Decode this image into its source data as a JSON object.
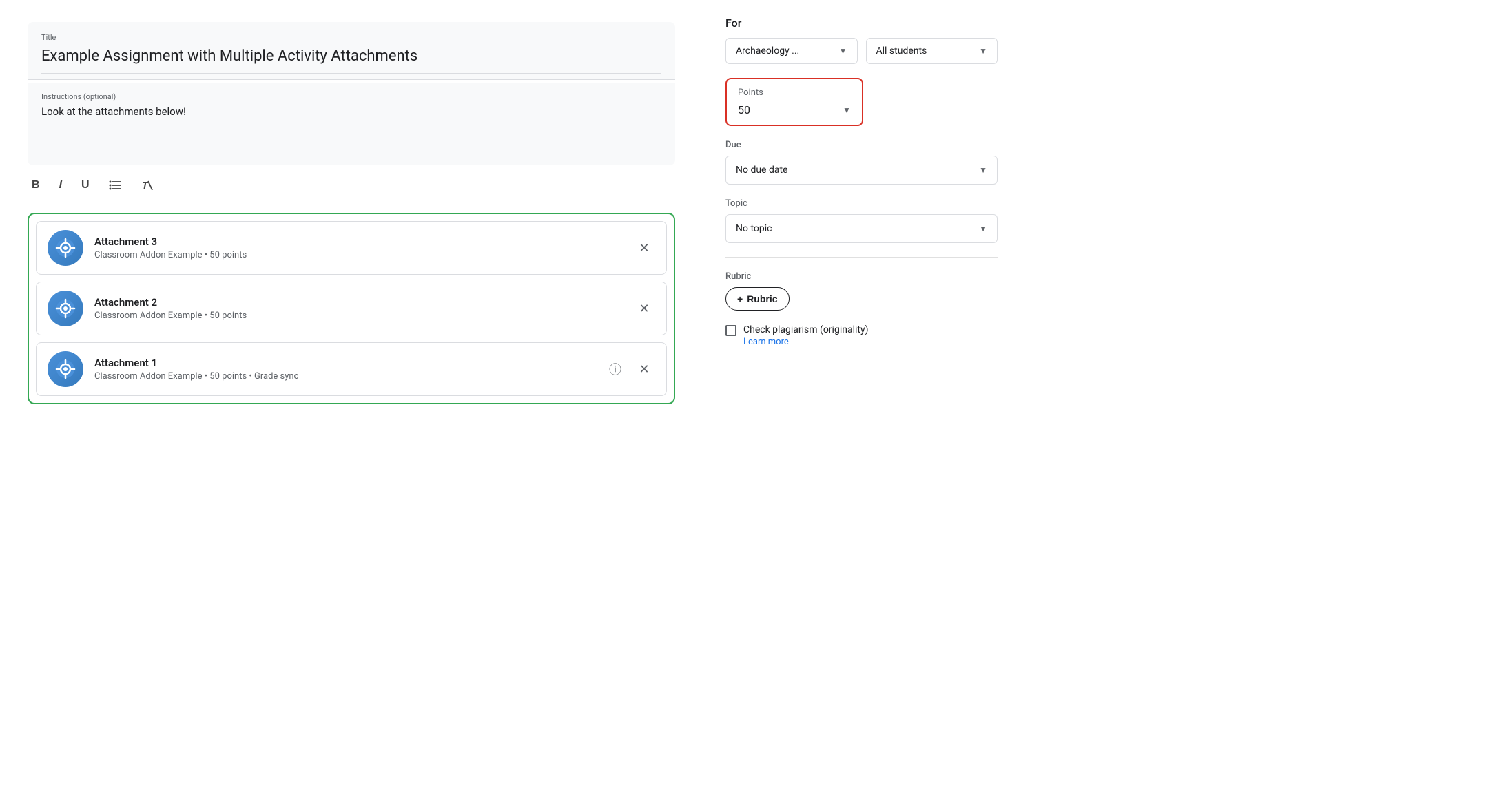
{
  "mainPanel": {
    "title": {
      "label": "Title",
      "value": "Example Assignment with Multiple Activity Attachments"
    },
    "instructions": {
      "label": "Instructions (optional)",
      "value": "Look at the attachments below!"
    },
    "toolbar": {
      "bold": "B",
      "italic": "I",
      "underline": "U",
      "list": "≡",
      "clearFormat": "✕"
    },
    "attachments": [
      {
        "id": "attachment-3",
        "name": "Attachment 3",
        "meta": "Classroom Addon Example • 50 points",
        "hasInfo": false
      },
      {
        "id": "attachment-2",
        "name": "Attachment 2",
        "meta": "Classroom Addon Example • 50 points",
        "hasInfo": false
      },
      {
        "id": "attachment-1",
        "name": "Attachment 1",
        "meta": "Classroom Addon Example • 50 points • Grade sync",
        "hasInfo": true
      }
    ]
  },
  "sidePanel": {
    "forLabel": "For",
    "class": {
      "value": "Archaeology ...",
      "dropdownArrow": "▼"
    },
    "students": {
      "value": "All students",
      "dropdownArrow": "▼"
    },
    "points": {
      "label": "Points",
      "value": "50",
      "dropdownArrow": "▼"
    },
    "due": {
      "label": "Due",
      "value": "No due date",
      "dropdownArrow": "▼"
    },
    "topic": {
      "label": "Topic",
      "value": "No topic",
      "dropdownArrow": "▼"
    },
    "rubric": {
      "label": "Rubric",
      "buttonLabel": "Rubric",
      "plusSign": "+"
    },
    "plagiarism": {
      "label": "Check plagiarism (originality)",
      "learnMore": "Learn more"
    }
  },
  "icons": {
    "close": "✕",
    "info": "ⓘ",
    "plus": "+",
    "bold": "B",
    "italic": "I",
    "underline": "U",
    "list": "list-icon",
    "clearFormat": "clear-format-icon"
  }
}
